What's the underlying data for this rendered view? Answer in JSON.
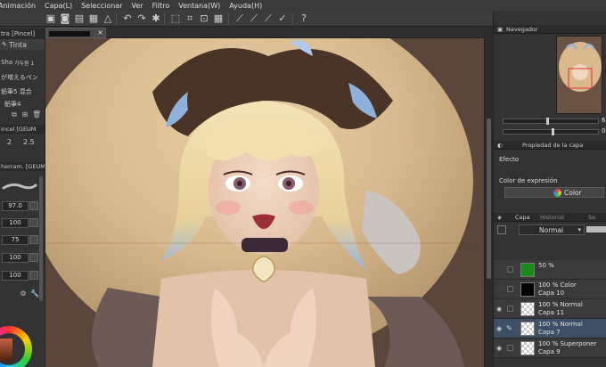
{
  "menubar": {
    "items": [
      "Animación",
      "Capa(L)",
      "Seleccionar",
      "Ver",
      "Filtro",
      "Ventana(W)",
      "Ayuda(H)"
    ]
  },
  "left_panel": {
    "tool_tab_1": "tra [Pincel]",
    "tool_tab_2": "Tinta",
    "brush_1": "Sha",
    "brush_1_tag": "가두원 1",
    "brush_2": "が増えるペン",
    "brush_3": "鉛筆5 混合",
    "brush_4": "鉛筆4",
    "sub_label_1": "incel [GEUM",
    "size_a": "2",
    "size_b": "2.5",
    "sub_label_2": "herram. [GEUM",
    "field_1": "97.0",
    "field_2": "100",
    "field_3": "75",
    "field_4": "100",
    "field_5": "100"
  },
  "document": {
    "tab_close": "×"
  },
  "right_panel": {
    "navigator_tab": "Navegador",
    "nav_value_1": "6",
    "nav_value_2": "0",
    "layer_props_tab": "Propiedad de la capa",
    "effect_label": "Efecto",
    "expression_color_label": "Color de expresión",
    "color_button": "Color",
    "layer_tab": "Capa",
    "history_tab": "Historial",
    "layer_tab_3": "Se",
    "blend_mode": "Normal",
    "layers": [
      {
        "line1": "50 %",
        "line2": "",
        "thumb": "#1a8a1a"
      },
      {
        "line1": "100 % Color",
        "line2": "Capa 10",
        "thumb": "#000000"
      },
      {
        "line1": "100 % Normal",
        "line2": "Capa 11",
        "thumb": "checker"
      },
      {
        "line1": "100 % Normal",
        "line2": "Capa 7",
        "thumb": "checker"
      },
      {
        "line1": "100 % Superponer",
        "line2": "Capa 9",
        "thumb": "checker"
      }
    ]
  },
  "colors": {
    "accent_blue": "#3f4f66",
    "layer_green": "#1a8a1a",
    "panel_bg": "#333333"
  }
}
